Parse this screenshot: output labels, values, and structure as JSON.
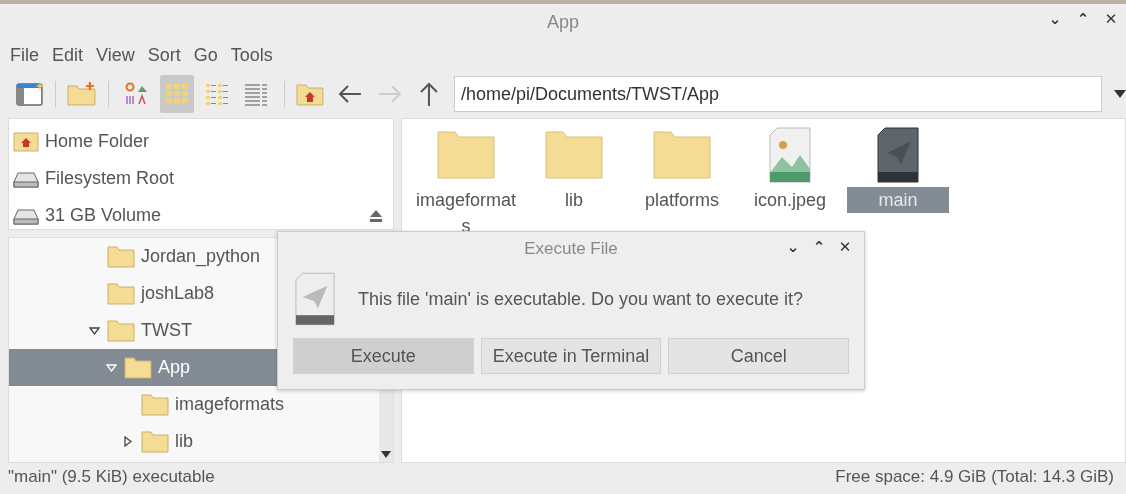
{
  "window": {
    "title": "App",
    "controls": [
      "⌄",
      "⌃",
      "✕"
    ]
  },
  "menu": [
    "File",
    "Edit",
    "View",
    "Sort",
    "Go",
    "Tools"
  ],
  "toolbar": {
    "view_modes": [
      {
        "kind": "thumbnails",
        "selected": false
      },
      {
        "kind": "icons",
        "selected": true
      },
      {
        "kind": "compact",
        "selected": false
      },
      {
        "kind": "list",
        "selected": false
      }
    ],
    "back_enabled": true,
    "forward_enabled": false,
    "path": "/home/pi/Documents/TWST/App"
  },
  "places": [
    {
      "kind": "home",
      "label": "Home Folder"
    },
    {
      "kind": "drive",
      "label": "Filesystem Root"
    },
    {
      "kind": "volume",
      "label": "31 GB Volume",
      "ejectable": true
    }
  ],
  "tree": [
    {
      "label": "Jordan_python",
      "kind": "leaf",
      "selected": false
    },
    {
      "label": "joshLab8",
      "kind": "leaf",
      "selected": false
    },
    {
      "label": "TWST",
      "kind": "branch",
      "expanded": true,
      "selected": false,
      "children": [
        {
          "label": "App",
          "kind": "branch",
          "expanded": true,
          "selected": true,
          "children": [
            {
              "label": "imageformats",
              "kind": "leaf",
              "selected": false
            },
            {
              "label": "lib",
              "kind": "branch",
              "expanded": false,
              "selected": false
            }
          ]
        }
      ]
    }
  ],
  "files": [
    {
      "kind": "folder",
      "name": "imageformats",
      "selected": false
    },
    {
      "kind": "folder",
      "name": "lib",
      "selected": false
    },
    {
      "kind": "folder",
      "name": "platforms",
      "selected": false
    },
    {
      "kind": "image",
      "name": "icon.jpeg",
      "selected": false
    },
    {
      "kind": "executable",
      "name": "main",
      "selected": true
    }
  ],
  "dialog": {
    "title": "Execute File",
    "controls": [
      "⌄",
      "⌃",
      "✕"
    ],
    "message": "This file 'main' is executable. Do you want to execute it?",
    "buttons": [
      {
        "label": "Execute",
        "selected": true
      },
      {
        "label": "Execute in Terminal",
        "selected": false
      },
      {
        "label": "Cancel",
        "selected": false
      }
    ]
  },
  "status_bar": {
    "left": "\"main\" (9.5 KiB) executable",
    "right": "Free space: 4.9 GiB (Total: 14.3 GiB)"
  }
}
